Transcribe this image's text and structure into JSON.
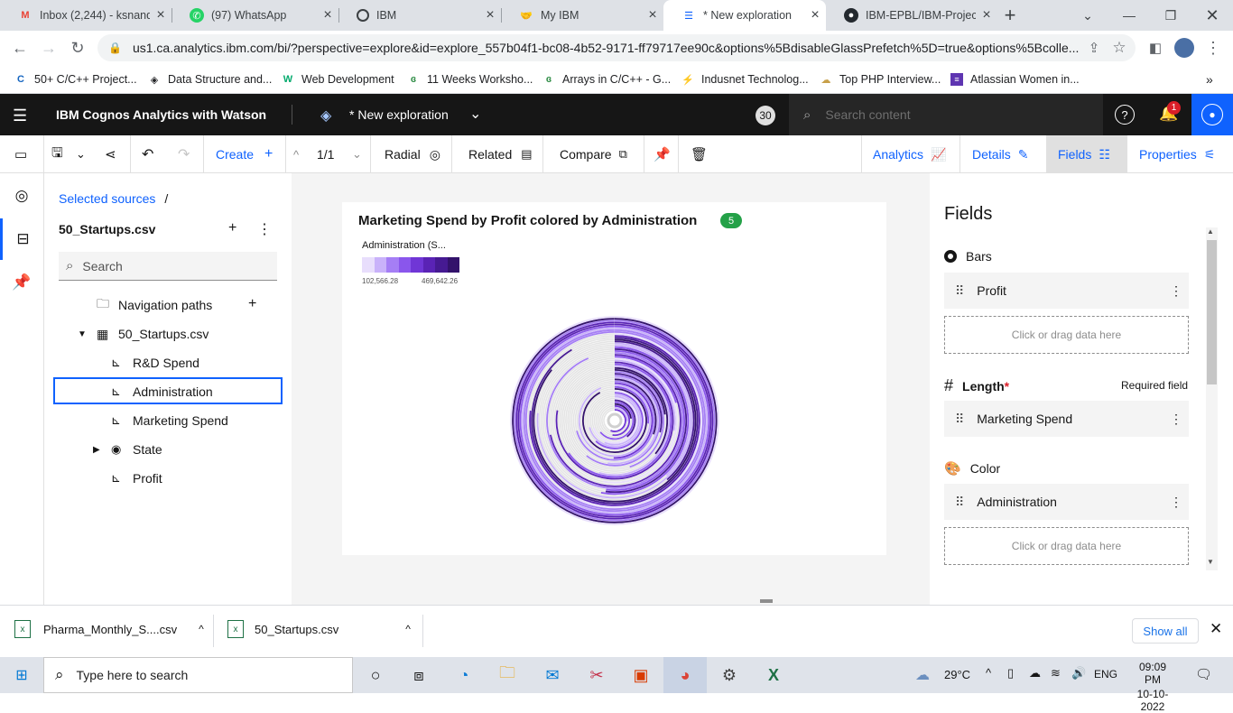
{
  "browser": {
    "tabs": [
      {
        "title": "Inbox (2,244) - ksnandi",
        "icon": "gmail-icon",
        "color": "#ea4335"
      },
      {
        "title": "(97) WhatsApp",
        "icon": "whatsapp-icon",
        "color": "#25d366"
      },
      {
        "title": "IBM",
        "icon": "globe-icon",
        "color": "#3c4043"
      },
      {
        "title": "My IBM",
        "icon": "handshake-icon",
        "color": "#3c4043"
      },
      {
        "title": "* New exploration",
        "icon": "cognos-icon",
        "color": "#0f62fe"
      },
      {
        "title": "IBM-EPBL/IBM-Project",
        "icon": "github-icon",
        "color": "#24292f"
      }
    ],
    "url": "us1.ca.analytics.ibm.com/bi/?perspective=explore&id=explore_557b04f1-bc08-4b52-9171-ff79717ee90c&options%5BdisableGlassPrefetch%5D=true&options%5Bcolle...",
    "bookmarks": [
      {
        "label": "50+ C/C++ Project...",
        "icon": "c-icon"
      },
      {
        "label": "Data Structure and...",
        "icon": "diamond-icon"
      },
      {
        "label": "Web Development",
        "icon": "w3-icon"
      },
      {
        "label": "11 Weeks Worksho...",
        "icon": "gfg-icon"
      },
      {
        "label": "Arrays in C/C++ - G...",
        "icon": "gfg-icon"
      },
      {
        "label": "Indusnet Technolog...",
        "icon": "bolt-icon"
      },
      {
        "label": "Top PHP Interview...",
        "icon": "cloud-icon"
      },
      {
        "label": "Atlassian Women in...",
        "icon": "list-icon"
      }
    ]
  },
  "app": {
    "title": "IBM Cognos Analytics with Watson",
    "exploration_title": "* New exploration",
    "badge_count": "30",
    "search_placeholder": "Search content",
    "notification_count": "1"
  },
  "toolbar": {
    "create": "Create",
    "page": "1/1",
    "radial": "Radial",
    "related": "Related",
    "compare": "Compare",
    "analytics": "Analytics",
    "details": "Details",
    "fields": "Fields",
    "properties": "Properties"
  },
  "sources": {
    "breadcrumb": "Selected sources",
    "breadcrumb_sep": "/",
    "file": "50_Startups.csv",
    "search_placeholder": "Search",
    "items": [
      {
        "label": "Navigation paths",
        "icon": "folder-icon"
      },
      {
        "label": "50_Startups.csv",
        "icon": "table-icon"
      },
      {
        "label": "R&D Spend",
        "icon": "measure-icon"
      },
      {
        "label": "Administration",
        "icon": "measure-icon"
      },
      {
        "label": "Marketing Spend",
        "icon": "measure-icon"
      },
      {
        "label": "State",
        "icon": "location-icon"
      },
      {
        "label": "Profit",
        "icon": "measure-icon"
      }
    ]
  },
  "visualization": {
    "title": "Marketing Spend by Profit colored by Administration",
    "badge": "5",
    "legend_title": "Administration (S...",
    "legend_min": "102,566.28",
    "legend_max": "469,642.26",
    "legend_colors": [
      "#e8defc",
      "#c9b2fa",
      "#a57ef5",
      "#8a56ec",
      "#7036d6",
      "#5a23b5",
      "#461a92",
      "#33126b"
    ]
  },
  "chart_data": {
    "type": "radial",
    "title": "Marketing Spend by Profit colored by Administration",
    "bars": "Profit",
    "length": "Marketing Spend",
    "color": "Administration",
    "color_range": [
      102566.28,
      469642.26
    ]
  },
  "fields": {
    "heading": "Fields",
    "bars_label": "Bars",
    "bars_value": "Profit",
    "drop_text": "Click or drag data here",
    "length_label": "Length",
    "required_star": "*",
    "required_text": "Required field",
    "length_value": "Marketing Spend",
    "color_label": "Color",
    "color_value": "Administration",
    "drop_text2": "Click or drag data here"
  },
  "downloads": {
    "items": [
      "Pharma_Monthly_S....csv",
      "50_Startups.csv"
    ],
    "show_all": "Show all"
  },
  "taskbar": {
    "search_placeholder": "Type here to search",
    "weather": "29°C",
    "lang": "ENG",
    "time": "09:09 PM",
    "date": "10-10-2022"
  }
}
